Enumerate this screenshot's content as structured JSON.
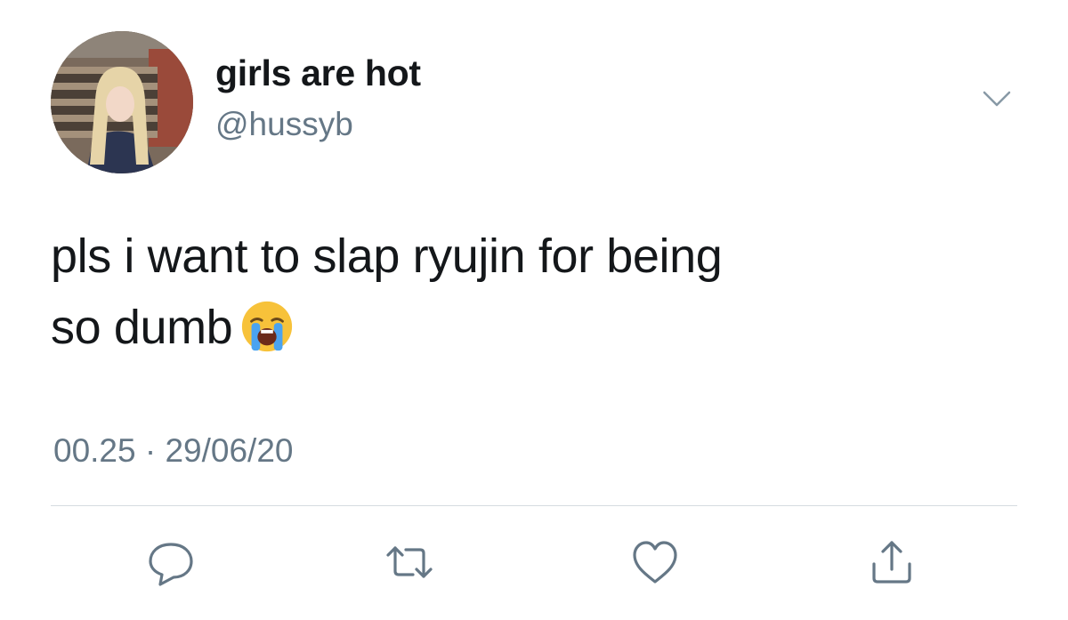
{
  "tweet": {
    "author": {
      "display_name": "girls are hot",
      "handle": "@hussyb",
      "avatar_icon": "profile-photo"
    },
    "text_lines": [
      "pls i want to slap ryujin for being",
      "so dumb"
    ],
    "emoji": {
      "name": "loudly-crying-face",
      "alt": "😭"
    },
    "timestamp": "00.25 · 29/06/20",
    "menu_icon": "chevron-down-icon"
  },
  "actions": [
    {
      "name": "reply",
      "icon": "speech-bubble-icon"
    },
    {
      "name": "retweet",
      "icon": "retweet-arrows-icon"
    },
    {
      "name": "like",
      "icon": "heart-icon"
    },
    {
      "name": "share",
      "icon": "share-upload-icon"
    }
  ],
  "colors": {
    "primary_text": "#14171a",
    "secondary_text": "#657786",
    "icon_gray": "#657786",
    "divider": "#d5dbe0",
    "background": "#ffffff"
  }
}
